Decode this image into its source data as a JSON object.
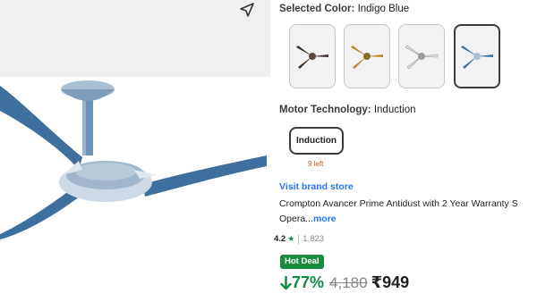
{
  "product": {
    "selected_color_label": "Selected Color:",
    "selected_color_value": "Indigo Blue",
    "motor_label": "Motor Technology:",
    "motor_value": "Induction",
    "motor_option": "Induction",
    "stock_note": "9 left",
    "brand_link": "Visit brand store",
    "title_line1": "Crompton Avancer Prime Antidust with 2 Year Warranty S",
    "title_line2": "Opera...",
    "more_link": "more",
    "rating": "4.2",
    "rating_count": "1,823",
    "hot_deal": "Hot Deal",
    "discount": "77%",
    "mrp": "4,180",
    "price": "₹949"
  },
  "swatches": [
    {
      "name": "dark-brown",
      "blade": "#3b302b",
      "selected": false
    },
    {
      "name": "gold",
      "blade": "#b8862f",
      "selected": false
    },
    {
      "name": "white",
      "blade": "#ededed",
      "selected": false
    },
    {
      "name": "indigo-blue",
      "blade": "#3d6f9e",
      "selected": true
    }
  ],
  "colors": {
    "fan_blade": "#3e6f9d",
    "fan_accent": "#a9bfd3",
    "link": "#2874f0",
    "deal_green": "#1a8a3d",
    "stock_orange": "#c0571f"
  },
  "icons": {
    "share": "share-arrow-icon",
    "star": "star-icon",
    "discount": "arrow-down-icon"
  }
}
